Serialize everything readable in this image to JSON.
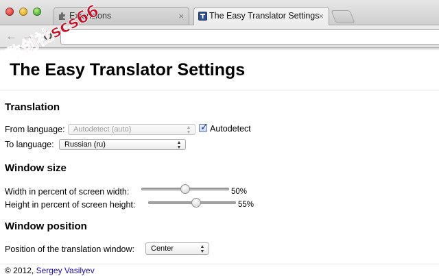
{
  "browser": {
    "tabs": [
      {
        "label": "Extensions",
        "icon": "puzzle-icon"
      },
      {
        "label": "The Easy Translator Settings",
        "icon": "translator-icon"
      }
    ],
    "close_glyph": "×"
  },
  "watermark": {
    "text": "数创社scs66"
  },
  "page": {
    "title": "The Easy Translator Settings",
    "translation": {
      "heading": "Translation",
      "from_label": "From language:",
      "from_value": "Autodetect (auto)",
      "autodetect_label": "Autodetect",
      "autodetect_checked": true,
      "to_label": "To language:",
      "to_value": "Russian (ru)"
    },
    "window_size": {
      "heading": "Window size",
      "width_label": "Width in percent of screen width:",
      "width_value": 50,
      "width_text": "50%",
      "height_label": "Height in percent of screen height:",
      "height_value": 55,
      "height_text": "55%"
    },
    "window_position": {
      "heading": "Window position",
      "position_label": "Position of the translation window:",
      "position_value": "Center"
    },
    "footer": {
      "copyright": "© 2012,",
      "author": "Sergey Vasilyev"
    }
  },
  "colors": {
    "link": "#1a0dab",
    "stamp": "#c0142c"
  }
}
